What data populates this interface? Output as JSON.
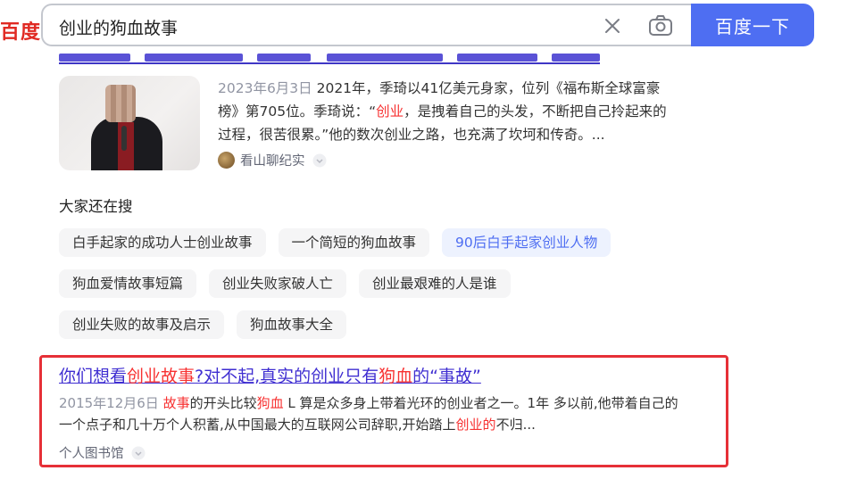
{
  "logo": {
    "text": "百度"
  },
  "search": {
    "query": "创业的狗血故事",
    "button_label": "百度一下"
  },
  "result1": {
    "date": "2023年6月3日",
    "snippet_parts": [
      " 2021年，季琦以41亿美元身家，位列《福布斯全球富豪榜》第705位。季琦说：“",
      "创业",
      "，是拽着自己的头发，不断把自己拎起来的过程，很苦很累。”他的数次创业之路，也充满了坎坷和传奇。..."
    ],
    "source": "看山聊纪实"
  },
  "related": {
    "title": "大家还在搜",
    "rows": [
      [
        "白手起家的成功人士创业故事",
        "一个简短的狗血故事",
        "90后白手起家创业人物"
      ],
      [
        "狗血爱情故事短篇",
        "创业失败家破人亡",
        "创业最艰难的人是谁"
      ],
      [
        "创业失败的故事及启示",
        "狗血故事大全"
      ]
    ]
  },
  "result2": {
    "title_parts": [
      "你们想看",
      "创业故事",
      "?对不起,真实的创业只有",
      "狗血",
      "的“事故”"
    ],
    "date": "2015年12月6日",
    "snippet_parts": [
      " ",
      "故事",
      "的开头比较",
      "狗血",
      " L 算是众多身上带着光环的创业者之一。1年 多以前,他带着自己的一个点子和几十万个人积蓄,从中国最大的互联网公司辞职,开始踏上",
      "创业的",
      "不归..."
    ],
    "source": "个人图书馆"
  },
  "colors": {
    "brand_blue": "#4e6ef2",
    "highlight_red": "#f73131",
    "title_purple": "#3f2ed1",
    "frame_red": "#e63037"
  }
}
